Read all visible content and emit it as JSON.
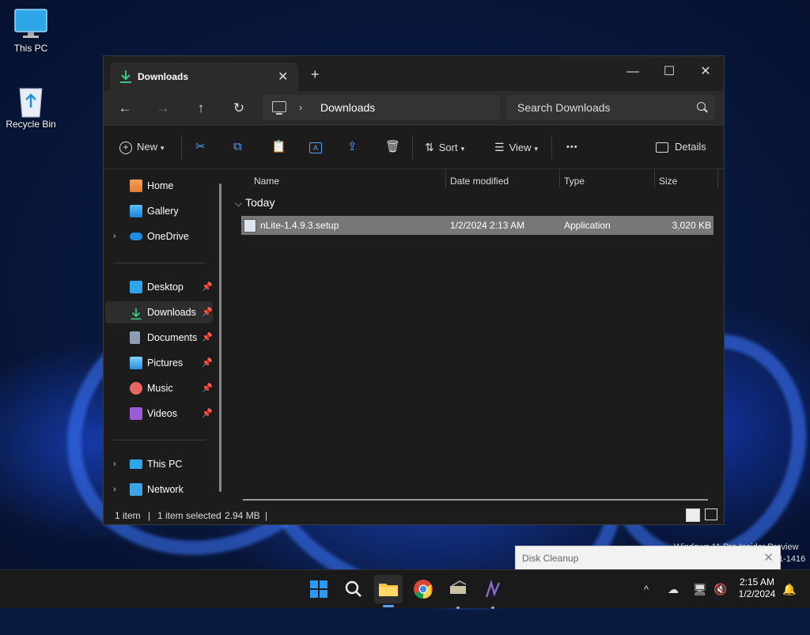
{
  "desktop": {
    "icons": [
      {
        "label": "This PC",
        "icon": "monitor-icon"
      },
      {
        "label": "Recycle Bin",
        "icon": "recycle-bin-icon"
      }
    ]
  },
  "window": {
    "tab_title": "Downloads",
    "tab_close": "✕",
    "new_tab": "+",
    "controls": {
      "minimize": "—",
      "maximize": "☐",
      "close": "✕"
    },
    "nav": {
      "back": "←",
      "forward": "→",
      "up": "↑",
      "refresh": "↻"
    },
    "address": {
      "chevron": "›",
      "location": "Downloads"
    },
    "search": {
      "placeholder": "Search Downloads"
    },
    "commandbar": {
      "new_label": "New",
      "sort_label": "Sort",
      "view_label": "View",
      "more_label": "•••",
      "details_label": "Details"
    },
    "sidebar": {
      "top": [
        {
          "label": "Home",
          "icon": "home-icon"
        },
        {
          "label": "Gallery",
          "icon": "gallery-icon"
        },
        {
          "label": "OneDrive",
          "icon": "cloud-icon",
          "expander": "›"
        }
      ],
      "pinned": [
        {
          "label": "Desktop",
          "icon": "desktop-icon",
          "pinned": true
        },
        {
          "label": "Downloads",
          "icon": "download-icon",
          "pinned": true,
          "selected": true
        },
        {
          "label": "Documents",
          "icon": "documents-icon",
          "pinned": true
        },
        {
          "label": "Pictures",
          "icon": "pictures-icon",
          "pinned": true
        },
        {
          "label": "Music",
          "icon": "music-icon",
          "pinned": true
        },
        {
          "label": "Videos",
          "icon": "videos-icon",
          "pinned": true
        }
      ],
      "bottom": [
        {
          "label": "This PC",
          "icon": "computer-icon",
          "expander": "›"
        },
        {
          "label": "Network",
          "icon": "network-icon",
          "expander": "›"
        }
      ],
      "pin_glyph": "📌"
    },
    "columns": {
      "name": "Name",
      "date": "Date modified",
      "type": "Type",
      "size": "Size"
    },
    "group": {
      "label": "Today",
      "chevron": "⌄"
    },
    "files": [
      {
        "name": "nLite-1.4.9.3.setup",
        "date": "1/2/2024 2:13 AM",
        "type": "Application",
        "size": "3,020 KB",
        "selected": true
      }
    ],
    "status": {
      "count": "1 item",
      "selection": "1 item selected",
      "size": "2.94 MB",
      "divider": "|"
    }
  },
  "toast": {
    "title": "Disk Cleanup",
    "close": "✕"
  },
  "watermark": {
    "line1": "Windows 11 Pro Insider Preview",
    "line2": "1-1416"
  },
  "taskbar": {
    "apps": [
      "start-icon",
      "search-icon",
      "file-explorer-icon",
      "chrome-icon",
      "app-installer-icon",
      "notepad-icon"
    ],
    "tray": {
      "chevron": "^",
      "time": "2:15 AM",
      "date": "1/2/2024"
    }
  },
  "colors": {
    "accent": "#0078d4",
    "download_green": "#3cc87a",
    "selection_row": "#777777"
  }
}
